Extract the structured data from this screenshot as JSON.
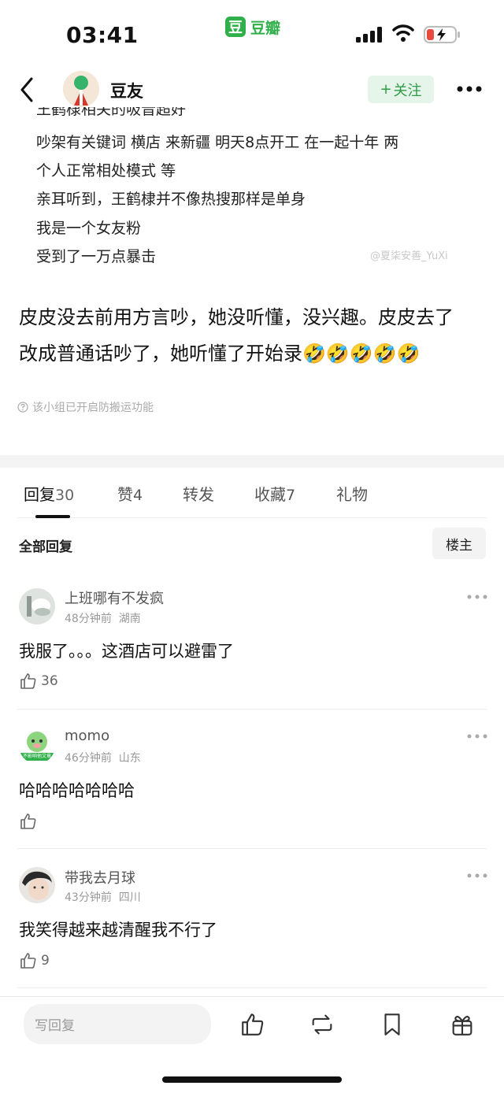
{
  "status_bar": {
    "time": "03:41",
    "app_logo": "豆",
    "app_name": "豆瓣"
  },
  "nav": {
    "username": "豆友",
    "follow_label": "关注",
    "follow_plus": "+"
  },
  "post": {
    "cut_line": "王鹤棣相关的吸音超好",
    "quote_lines": [
      "吵架有关键词 横店 来新疆 明天8点开工 在一起十年 两",
      "个人正常相处模式 等",
      "亲耳听到，王鹤棣并不像热搜那样是单身",
      "我是一个女友粉",
      "受到了一万点暴击"
    ],
    "watermark": "@夏柒安善_YuXi",
    "main_line1": "皮皮没去前用方言吵，她没听懂，没兴趣。皮皮去了",
    "main_line2": "改成普通话吵了，她听懂了开始录",
    "emojis": "🤣🤣🤣🤣🤣",
    "notice": "该小组已开启防搬运功能"
  },
  "tabs": [
    {
      "label": "回复",
      "count": "30"
    },
    {
      "label": "赞",
      "count": "4"
    },
    {
      "label": "转发",
      "count": ""
    },
    {
      "label": "收藏",
      "count": "7"
    },
    {
      "label": "礼物",
      "count": ""
    }
  ],
  "replies_header": {
    "title": "全部回复",
    "op_button": "楼主"
  },
  "comments": [
    {
      "name": "上班哪有不发疯",
      "time": "48分钟前",
      "location": "湖南",
      "text": "我服了。。。这酒店可以避雷了",
      "likes": "36"
    },
    {
      "name": "momo",
      "time": "46分钟前",
      "location": "山东",
      "text": "哈哈哈哈哈哈哈",
      "likes": ""
    },
    {
      "name": "带我去月球",
      "time": "43分钟前",
      "location": "四川",
      "text": "我笑得越来越清醒我不行了",
      "likes": "9"
    }
  ],
  "momo_badge": "不影响他文章",
  "bottom_bar": {
    "reply_placeholder": "写回复"
  },
  "colors": {
    "brand_green": "#2fb04a",
    "follow_bg": "#e5f5ea",
    "follow_text": "#2f9b47"
  }
}
